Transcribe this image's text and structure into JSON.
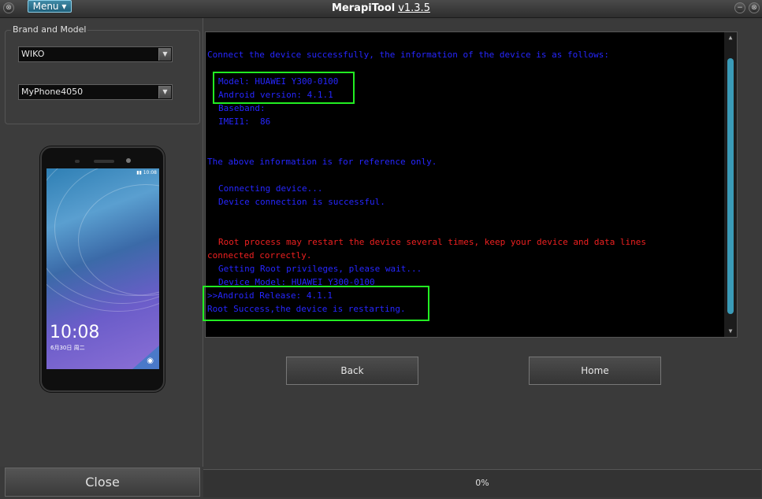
{
  "titlebar": {
    "menu_label": "Menu ▾",
    "app_name": "MerapiTool",
    "version": "v1.3.5",
    "left_icon": "window-control-icon",
    "right_icons": [
      "minimize-icon",
      "close-window-icon"
    ]
  },
  "brand_model": {
    "group_label": "Brand and Model",
    "brand_value": "WIKO",
    "model_value": "MyPhone4050"
  },
  "phone_preview": {
    "clock": "10:08",
    "date": "6月30日  周二",
    "status": "▮▮ 10:08"
  },
  "console": {
    "lines": [
      {
        "text": "Connect the device successfully, the information of the device is as follows:",
        "color": "blue",
        "indent": 0
      },
      {
        "text": "Model: HUAWEI Y300-0100",
        "color": "blue",
        "indent": 2
      },
      {
        "text": "Android version: 4.1.1",
        "color": "blue",
        "indent": 2
      },
      {
        "text": "Baseband:",
        "color": "blue",
        "indent": 2
      },
      {
        "text": "IMEI1:  86",
        "color": "blue",
        "indent": 2
      },
      {
        "text": "The above information is for reference only.",
        "color": "blue",
        "indent": 0
      },
      {
        "text": "Connecting device...",
        "color": "blue",
        "indent": 2
      },
      {
        "text": "Device connection is successful.",
        "color": "blue",
        "indent": 2
      },
      {
        "text": "Root process may restart the device several times, keep your device and data lines",
        "color": "red",
        "indent": 2
      },
      {
        "text": "connected correctly.",
        "color": "red",
        "indent": 0
      },
      {
        "text": "Getting Root privileges, please wait...",
        "color": "blue",
        "indent": 2
      },
      {
        "text": "Device Model: HUAWEI Y300-0100",
        "color": "blue",
        "indent": 2
      },
      {
        "text": ">>Android Release: 4.1.1",
        "color": "blue",
        "indent": 0
      },
      {
        "text": "Root Success,the device is restarting.",
        "color": "blue",
        "indent": 0
      }
    ]
  },
  "buttons": {
    "back": "Back",
    "home": "Home",
    "close": "Close"
  },
  "progress": {
    "label": "0%",
    "value": 0
  },
  "colors": {
    "console_blue": "#2626ff",
    "console_red": "#ee2020",
    "highlight_green": "#22ee22",
    "accent": "#3a9bb8"
  }
}
